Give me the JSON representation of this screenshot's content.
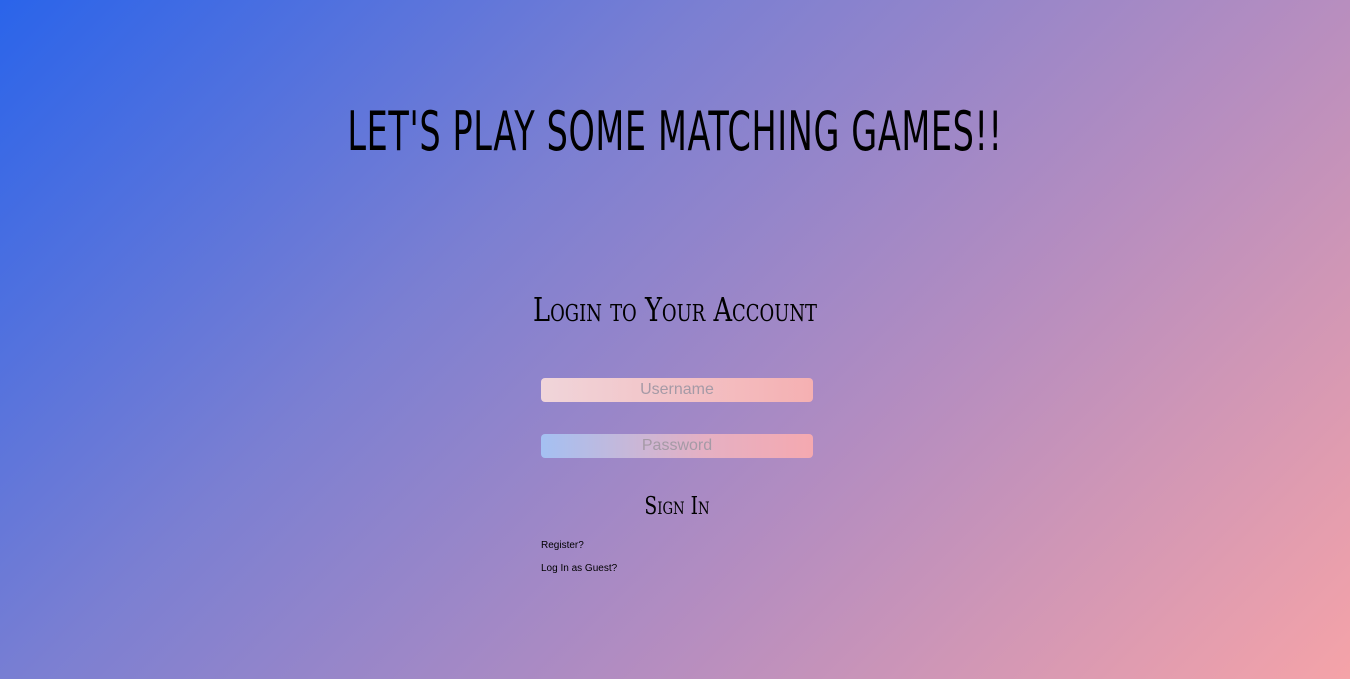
{
  "header": {
    "title": "LET'S PLAY SOME MATCHING GAMES!!"
  },
  "login": {
    "heading": "Login to Your Account",
    "username_placeholder": "Username",
    "password_placeholder": "Password",
    "signin_label": "Sign In",
    "register_label": "Register?",
    "guest_label": "Log In as Guest?"
  },
  "colors": {
    "gradient_start": "#2a64ea",
    "gradient_end": "#f5a3a8"
  }
}
